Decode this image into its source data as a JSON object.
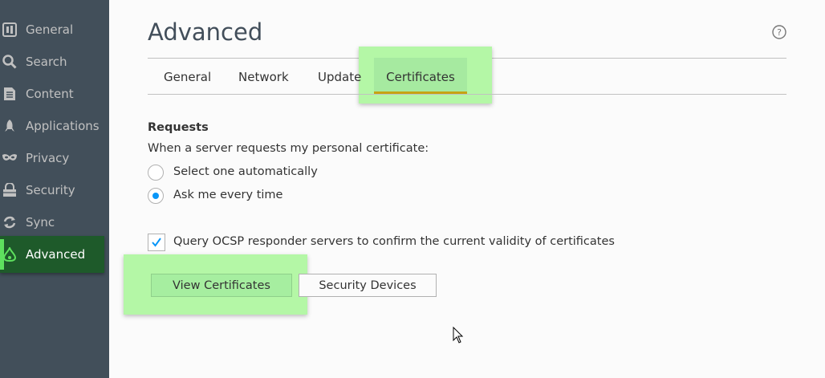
{
  "sidebar": {
    "items": [
      {
        "label": "General",
        "icon": "general-icon"
      },
      {
        "label": "Search",
        "icon": "search-icon"
      },
      {
        "label": "Content",
        "icon": "content-icon"
      },
      {
        "label": "Applications",
        "icon": "applications-icon"
      },
      {
        "label": "Privacy",
        "icon": "privacy-icon"
      },
      {
        "label": "Security",
        "icon": "security-icon"
      },
      {
        "label": "Sync",
        "icon": "sync-icon"
      },
      {
        "label": "Advanced",
        "icon": "advanced-icon",
        "selected": true
      }
    ]
  },
  "page": {
    "title": "Advanced",
    "help_icon": "help-icon"
  },
  "tabs": [
    {
      "label": "General"
    },
    {
      "label": "Network"
    },
    {
      "label": "Update"
    },
    {
      "label": "Certificates",
      "selected": true
    }
  ],
  "requests": {
    "heading": "Requests",
    "description": "When a server requests my personal certificate:",
    "options": [
      {
        "label": "Select one automatically",
        "checked": false
      },
      {
        "label": "Ask me every time",
        "checked": true
      }
    ]
  },
  "ocsp": {
    "label": "Query OCSP responder servers to confirm the current validity of certificates",
    "checked": true
  },
  "buttons": {
    "view_certificates": "View Certificates",
    "security_devices": "Security Devices"
  },
  "colors": {
    "sidebar_bg": "#424f5a",
    "highlight": "#b4f7a6",
    "selected_sidebar": "#1e5a2a",
    "tab_underline": "#c6a313",
    "radio_checked": "#0996f8"
  }
}
